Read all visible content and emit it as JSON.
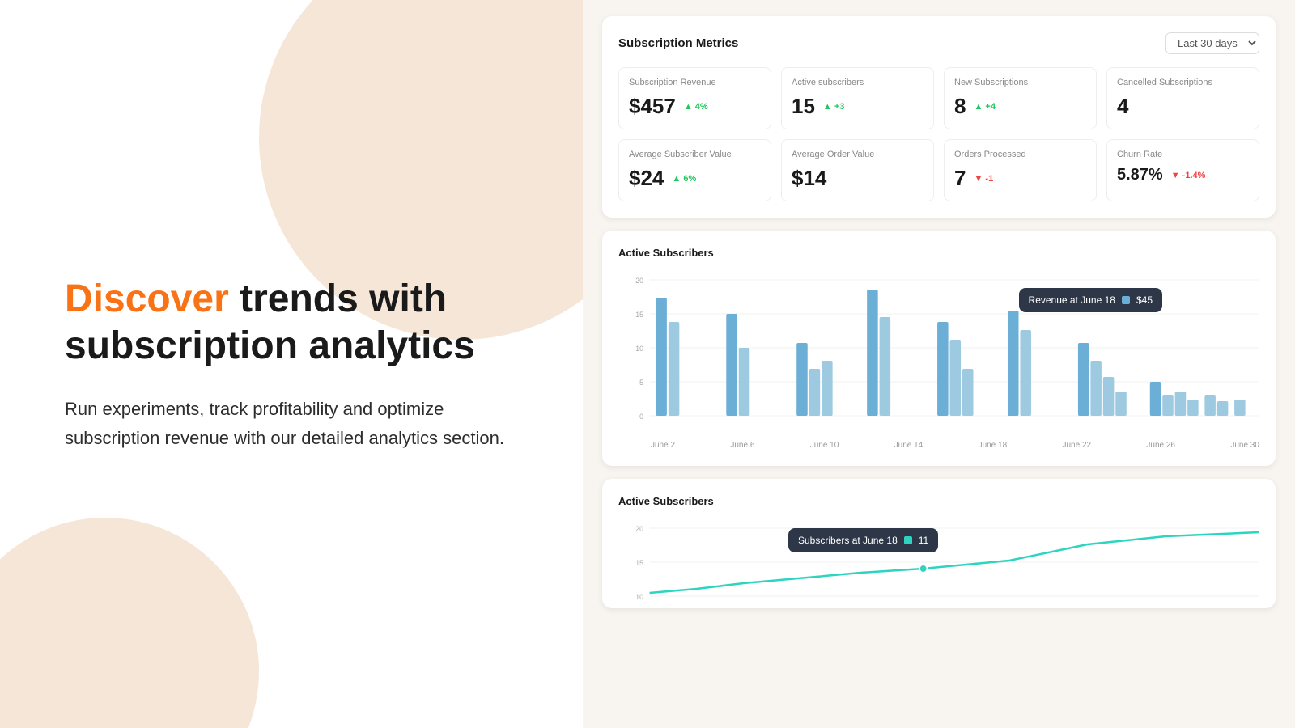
{
  "left": {
    "hero_title_1": "Discover",
    "hero_title_2": " trends with",
    "hero_title_3": "subscription analytics",
    "subtitle": "Run experiments, track profitability and optimize subscription revenue with our detailed analytics section."
  },
  "dashboard": {
    "title": "Subscription Metrics",
    "date_filter": "Last 30 days",
    "metrics_row1": [
      {
        "label": "Subscription Revenue",
        "value": "$457",
        "badge": "▲ 4%",
        "badge_type": "up"
      },
      {
        "label": "Active subscribers",
        "value": "15",
        "badge": "▲ +3",
        "badge_type": "up"
      },
      {
        "label": "New Subscriptions",
        "value": "8",
        "badge": "▲ +4",
        "badge_type": "up"
      },
      {
        "label": "Cancelled Subscriptions",
        "value": "4",
        "badge": "",
        "badge_type": ""
      }
    ],
    "metrics_row2": [
      {
        "label": "Average Subscriber Value",
        "value": "$24",
        "badge": "▲ 6%",
        "badge_type": "up"
      },
      {
        "label": "Average Order Value",
        "value": "$14",
        "badge": "",
        "badge_type": ""
      },
      {
        "label": "Orders Processed",
        "value": "7",
        "badge": "▼ -1",
        "badge_type": "down"
      },
      {
        "label": "Churn Rate",
        "value": "5.87%",
        "badge": "▼ -1.4%",
        "badge_type": "down"
      }
    ],
    "bar_chart_title": "Active Subscribers",
    "bar_chart_tooltip_label": "Revenue at June 18",
    "bar_chart_tooltip_value": "$45",
    "bar_chart_x_labels": [
      "June 2",
      "June 6",
      "June 10",
      "June 14",
      "June 18",
      "June 22",
      "June 26",
      "June 30"
    ],
    "bar_chart_y_labels": [
      "0",
      "5",
      "10",
      "15",
      "20"
    ],
    "line_chart_title": "Active Subscribers",
    "line_chart_tooltip_label": "Subscribers at June 18",
    "line_chart_tooltip_value": "11",
    "line_chart_y_labels": [
      "10",
      "15",
      "20"
    ]
  }
}
